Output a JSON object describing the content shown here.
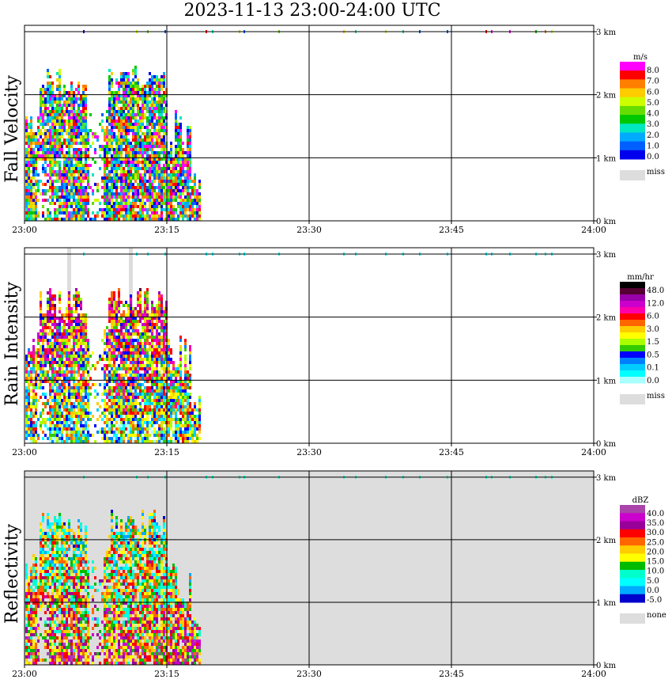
{
  "title": "2023-11-13  23:00-24:00 UTC",
  "x_ticks": [
    "23:00",
    "23:15",
    "23:30",
    "23:45",
    "24:00"
  ],
  "y_ticks": [
    "0 km",
    "1 km",
    "2 km",
    "3 km"
  ],
  "chart_data": [
    {
      "type": "heatmap",
      "panel_title": "Fall Velocity",
      "colorbar_unit": "m/s",
      "colorbar_labels": [
        "8.0",
        "7.0",
        "6.0",
        "5.0",
        "4.0",
        "3.0",
        "2.0",
        "1.0",
        "0.0"
      ],
      "missing_label": "miss",
      "colors": [
        "#ff00ff",
        "#ff0000",
        "#ff7f00",
        "#ffcc00",
        "#ccff00",
        "#66dd00",
        "#00c800",
        "#00e8c0",
        "#00aaff",
        "#0060ff",
        "#0000ee"
      ],
      "xlim": [
        "23:00",
        "24:00"
      ],
      "ylim_km": [
        0,
        3.1
      ],
      "cell_range": [
        0,
        11
      ],
      "background": "#ffffff",
      "missing_color": "#dddddd"
    },
    {
      "type": "heatmap",
      "panel_title": "Rain Intensity",
      "colorbar_unit": "mm/hr",
      "colorbar_labels": [
        "48.0",
        "12.0",
        "6.0",
        "3.0",
        "1.5",
        "0.5",
        "0.1",
        "0.0"
      ],
      "missing_label": "miss",
      "colors": [
        "#000000",
        "#550033",
        "#9900aa",
        "#cc00cc",
        "#ff00aa",
        "#ff0000",
        "#ff6600",
        "#ffcc00",
        "#ffff00",
        "#aaff00",
        "#33cc00",
        "#0000ff",
        "#0080ff",
        "#00ccff",
        "#00ffff",
        "#aaffff"
      ],
      "xlim": [
        "23:00",
        "24:00"
      ],
      "ylim_km": [
        0,
        3.1
      ],
      "cell_range": [
        0,
        16
      ],
      "background": "#ffffff",
      "missing_color": "#dddddd"
    },
    {
      "type": "heatmap",
      "panel_title": "Reflectivity",
      "colorbar_unit": "dBZ",
      "colorbar_labels": [
        "40.0",
        "35.0",
        "30.0",
        "25.0",
        "20.0",
        "15.0",
        "10.0",
        "5.0",
        "0.0",
        "-5.0"
      ],
      "missing_label": "none",
      "colors": [
        "#aa44aa",
        "#cc00cc",
        "#990099",
        "#ff0000",
        "#ff6600",
        "#ffcc00",
        "#ffff00",
        "#00bb00",
        "#00ffcc",
        "#00ffff",
        "#00aaff",
        "#0000cc"
      ],
      "xlim": [
        "23:00",
        "24:00"
      ],
      "ylim_km": [
        0,
        3.1
      ],
      "cell_range": [
        0,
        12
      ],
      "background": "#dddddd",
      "missing_color": "#dddddd"
    }
  ]
}
